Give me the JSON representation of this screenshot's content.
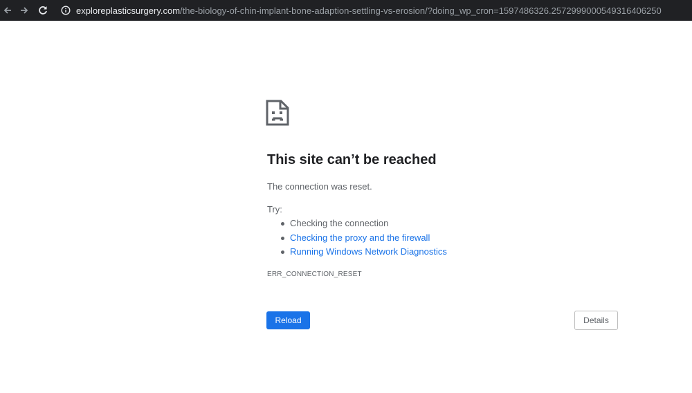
{
  "browser": {
    "url_host": "exploreplasticsurgery.com",
    "url_path": "/the-biology-of-chin-implant-bone-adaption-settling-vs-erosion/?doing_wp_cron=1597486326.2572999000549316406250",
    "icons": [
      "back-icon",
      "forward-icon",
      "reload-icon",
      "info-icon"
    ]
  },
  "error": {
    "title": "This site can’t be reached",
    "description": "The connection was reset.",
    "try_label": "Try:",
    "suggestions": [
      {
        "text": "Checking the connection",
        "link": false
      },
      {
        "text": "Checking the proxy and the firewall",
        "link": true
      },
      {
        "text": "Running Windows Network Diagnostics",
        "link": true
      }
    ],
    "code": "ERR_CONNECTION_RESET"
  },
  "buttons": {
    "reload": "Reload",
    "details": "Details"
  },
  "colors": {
    "accent": "#1a73e8",
    "toolbar": "#202124",
    "text": "#5f6368",
    "heading": "#202124"
  }
}
